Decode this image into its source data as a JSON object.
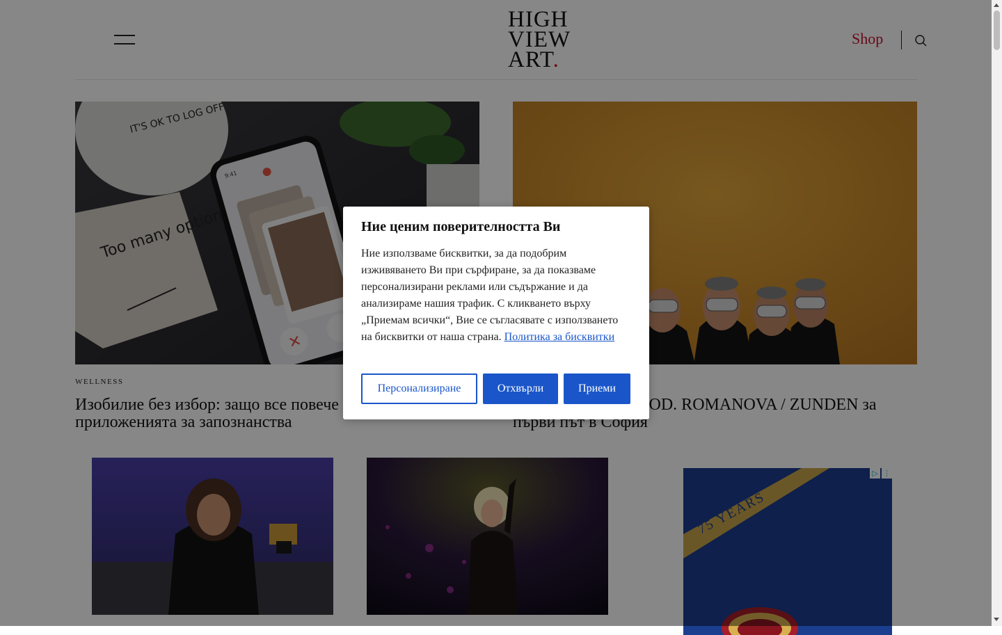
{
  "header": {
    "logo_lines": [
      "HIGH",
      "VIEW",
      "ART"
    ],
    "logo_dot": ".",
    "shop_label": "Shop"
  },
  "features": [
    {
      "category": "WELLNESS",
      "title": "Изобилие без избор: защо все повече хора изтриват приложенията за запознанства",
      "image": {
        "mug_text": "IT'S OK TO LOG OFF ♡",
        "note_text": "Too many options?",
        "phone_time": "9:41"
      }
    },
    {
      "title": "KRAFTWERK и MOD. ROMANOVA / ZUNDEN за първи път в София"
    }
  ],
  "ad": {
    "ribbon_text": "75 YEARS"
  },
  "cookie_modal": {
    "title": "Ние ценим поверителността Ви",
    "body": "Ние използваме бисквитки, за да подобрим изживяването Ви при сърфиране, за да показваме персонализирани реклами или съдържание и да анализираме нашия трафик. С кликването върху „Приемам всички“, Вие се съгласявате с използването на бисквитки от наша страна.",
    "policy_link": "Политика за бисквитки",
    "buttons": {
      "customize": "Персонализиране",
      "reject": "Отхвърли",
      "accept": "Приеми"
    }
  },
  "colors": {
    "accent_red": "#c8102e",
    "button_blue": "#1a56c9",
    "overlay": "rgba(0,0,0,0.47)"
  },
  "icons": {
    "menu": "hamburger-icon",
    "search": "search-icon"
  }
}
